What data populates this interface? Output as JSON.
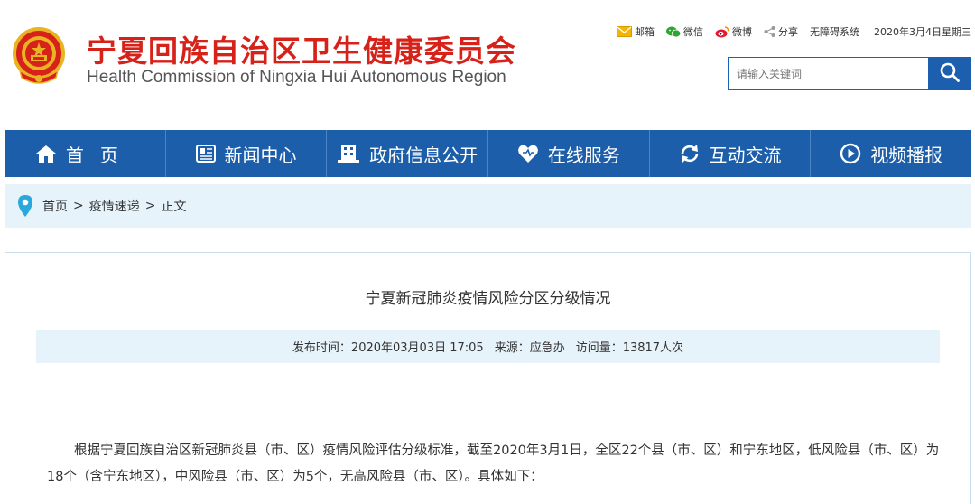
{
  "header": {
    "title_cn": "宁夏回族自治区卫生健康委员会",
    "title_en": "Health Commission of Ningxia Hui Autonomous Region",
    "top_links": {
      "mail": "邮箱",
      "wechat": "微信",
      "weibo": "微博",
      "share": "分享",
      "accessibility": "无障碍系统",
      "date": "2020年3月4日星期三"
    },
    "search": {
      "placeholder": "请输入关键词"
    }
  },
  "nav": {
    "items": [
      {
        "label": "首页",
        "icon": "home-icon"
      },
      {
        "label": "新闻中心",
        "icon": "news-icon"
      },
      {
        "label": "政府信息公开",
        "icon": "building-icon"
      },
      {
        "label": "在线服务",
        "icon": "heart-icon"
      },
      {
        "label": "互动交流",
        "icon": "refresh-icon"
      },
      {
        "label": "视频播报",
        "icon": "play-icon"
      }
    ]
  },
  "breadcrumb": {
    "items": [
      "首页",
      "疫情速递",
      "正文"
    ],
    "separator": ">"
  },
  "article": {
    "title": "宁夏新冠肺炎疫情风险分区分级情况",
    "meta": {
      "publish_time": "发布时间：2020年03月03日 17:05",
      "source": "来源：应急办",
      "views": "访问量：13817人次"
    },
    "body": "根据宁夏回族自治区新冠肺炎县（市、区）疫情风险评估分级标准，截至2020年3月1日，全区22个县（市、区）和宁东地区，低风险县（市、区）为18个（含宁东地区），中风险县（市、区）为5个，无高风险县（市、区）。具体如下："
  },
  "colors": {
    "brand_red": "#d7221a",
    "nav_blue": "#1c5ea9",
    "light_blue_bg": "#e7f3fb"
  }
}
